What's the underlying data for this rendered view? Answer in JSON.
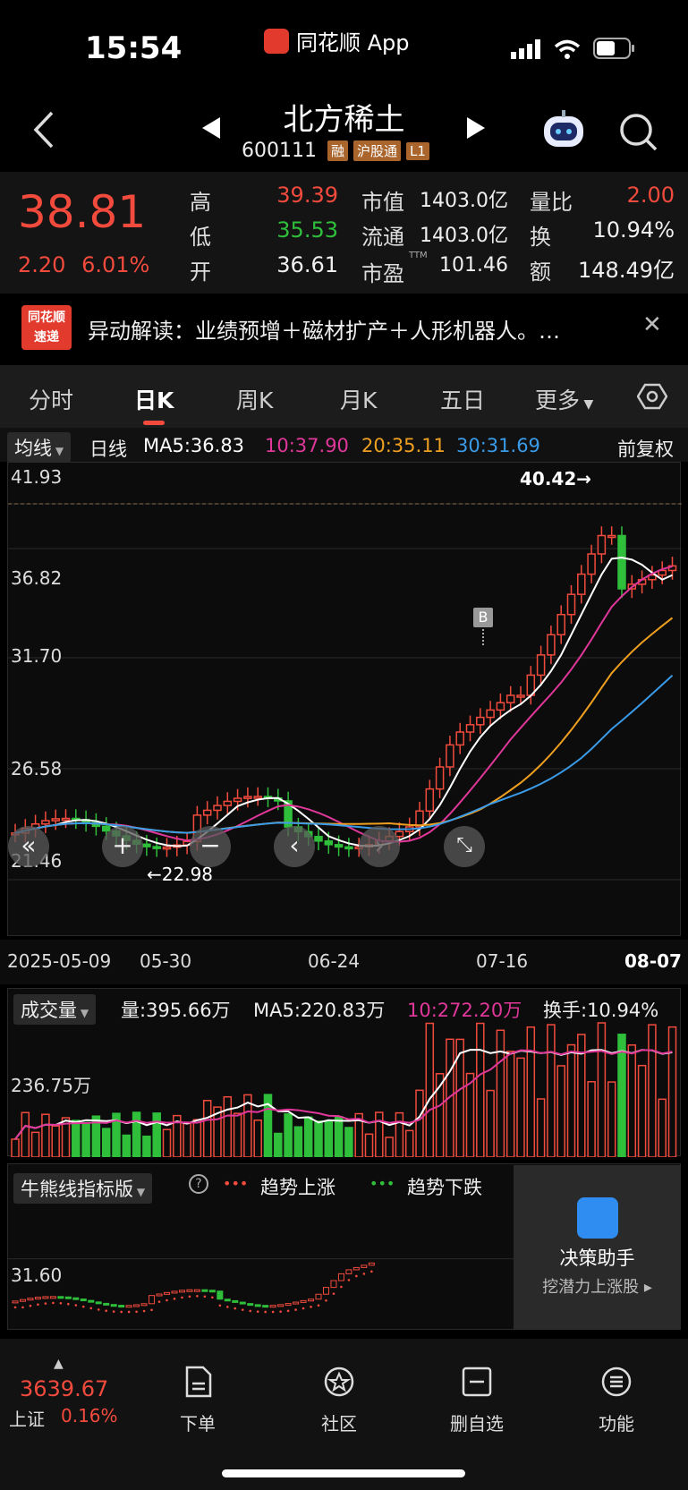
{
  "status_bar": {
    "time": "15:54",
    "app_name": "同花顺 App",
    "icons": [
      "signal-icon",
      "wifi-icon",
      "battery-icon"
    ]
  },
  "header": {
    "title": "北方稀土",
    "code": "600111",
    "tags": [
      "融",
      "沪股通",
      "L1"
    ]
  },
  "quote": {
    "price": "38.81",
    "change": "2.20",
    "change_pct": "6.01%",
    "high_label": "高",
    "high": "39.39",
    "low_label": "低",
    "low": "35.53",
    "open_label": "开",
    "open": "36.61",
    "mktcap_label": "市值",
    "mktcap": "1403.0亿",
    "float_label": "流通",
    "float": "1403.0亿",
    "pe_label": "市盈",
    "pe_sup": "TTM",
    "pe": "101.46",
    "volratio_label": "量比",
    "volratio": "2.00",
    "turnover_label": "换",
    "turnover": "10.94%",
    "amount_label": "额",
    "amount": "148.49亿"
  },
  "news": {
    "logo_top": "同花顺",
    "logo_bottom": "速递",
    "text": "异动解读：业绩预增＋磁材扩产＋人形机器人。…"
  },
  "tabs": [
    "分时",
    "日K",
    "周K",
    "月K",
    "五日",
    "更多"
  ],
  "ma_row": {
    "dropdown": "均线",
    "period": "日线",
    "ma5": "MA5:36.83",
    "ma10": "10:37.90",
    "ma20": "20:35.11",
    "ma30": "30:31.69",
    "adjust": "前复权"
  },
  "kline": {
    "y_labels": [
      "41.93",
      "36.82",
      "31.70",
      "26.58",
      "21.46"
    ],
    "high_marker": "40.42→",
    "low_marker": "←22.98",
    "buy_marker": "B"
  },
  "date_axis": [
    "2025-05-09",
    "05-30",
    "06-24",
    "07-16",
    "08-07"
  ],
  "volume": {
    "dropdown": "成交量",
    "vol": "量:395.66万",
    "ma5": "MA5:220.83万",
    "ma10": "10:272.20万",
    "turnover": "换手:10.94%",
    "y_label": "236.75万"
  },
  "indicator": {
    "dropdown": "牛熊线指标版",
    "up_label": "趋势上涨",
    "down_label": "趋势下跌",
    "y_label": "31.60"
  },
  "assistant": {
    "title": "决策助手",
    "subtitle": "挖潜力上涨股 ▸"
  },
  "bottom": {
    "index_value": "3639.67",
    "index_name": "上证",
    "index_pct": "0.16%",
    "nav": [
      "下单",
      "社区",
      "删自选",
      "功能"
    ]
  },
  "colors": {
    "up": "#f24b3d",
    "down": "#2fbf3b",
    "ma5": "#ffffff",
    "ma10": "#e0379a",
    "ma20": "#f0a020",
    "ma30": "#3a9be8"
  }
}
